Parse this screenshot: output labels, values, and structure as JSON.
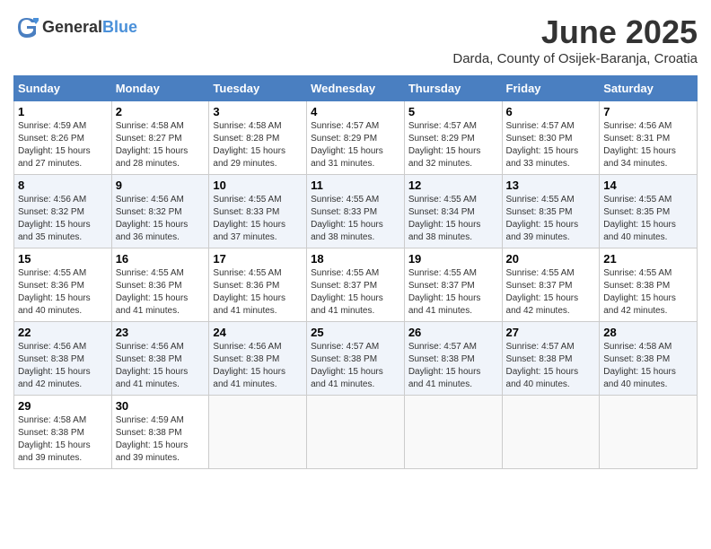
{
  "logo": {
    "general": "General",
    "blue": "Blue"
  },
  "title": "June 2025",
  "location": "Darda, County of Osijek-Baranja, Croatia",
  "days_header": [
    "Sunday",
    "Monday",
    "Tuesday",
    "Wednesday",
    "Thursday",
    "Friday",
    "Saturday"
  ],
  "weeks": [
    [
      {
        "day": "1",
        "info": "Sunrise: 4:59 AM\nSunset: 8:26 PM\nDaylight: 15 hours and 27 minutes."
      },
      {
        "day": "2",
        "info": "Sunrise: 4:58 AM\nSunset: 8:27 PM\nDaylight: 15 hours and 28 minutes."
      },
      {
        "day": "3",
        "info": "Sunrise: 4:58 AM\nSunset: 8:28 PM\nDaylight: 15 hours and 29 minutes."
      },
      {
        "day": "4",
        "info": "Sunrise: 4:57 AM\nSunset: 8:29 PM\nDaylight: 15 hours and 31 minutes."
      },
      {
        "day": "5",
        "info": "Sunrise: 4:57 AM\nSunset: 8:29 PM\nDaylight: 15 hours and 32 minutes."
      },
      {
        "day": "6",
        "info": "Sunrise: 4:57 AM\nSunset: 8:30 PM\nDaylight: 15 hours and 33 minutes."
      },
      {
        "day": "7",
        "info": "Sunrise: 4:56 AM\nSunset: 8:31 PM\nDaylight: 15 hours and 34 minutes."
      }
    ],
    [
      {
        "day": "8",
        "info": "Sunrise: 4:56 AM\nSunset: 8:32 PM\nDaylight: 15 hours and 35 minutes."
      },
      {
        "day": "9",
        "info": "Sunrise: 4:56 AM\nSunset: 8:32 PM\nDaylight: 15 hours and 36 minutes."
      },
      {
        "day": "10",
        "info": "Sunrise: 4:55 AM\nSunset: 8:33 PM\nDaylight: 15 hours and 37 minutes."
      },
      {
        "day": "11",
        "info": "Sunrise: 4:55 AM\nSunset: 8:33 PM\nDaylight: 15 hours and 38 minutes."
      },
      {
        "day": "12",
        "info": "Sunrise: 4:55 AM\nSunset: 8:34 PM\nDaylight: 15 hours and 38 minutes."
      },
      {
        "day": "13",
        "info": "Sunrise: 4:55 AM\nSunset: 8:35 PM\nDaylight: 15 hours and 39 minutes."
      },
      {
        "day": "14",
        "info": "Sunrise: 4:55 AM\nSunset: 8:35 PM\nDaylight: 15 hours and 40 minutes."
      }
    ],
    [
      {
        "day": "15",
        "info": "Sunrise: 4:55 AM\nSunset: 8:36 PM\nDaylight: 15 hours and 40 minutes."
      },
      {
        "day": "16",
        "info": "Sunrise: 4:55 AM\nSunset: 8:36 PM\nDaylight: 15 hours and 41 minutes."
      },
      {
        "day": "17",
        "info": "Sunrise: 4:55 AM\nSunset: 8:36 PM\nDaylight: 15 hours and 41 minutes."
      },
      {
        "day": "18",
        "info": "Sunrise: 4:55 AM\nSunset: 8:37 PM\nDaylight: 15 hours and 41 minutes."
      },
      {
        "day": "19",
        "info": "Sunrise: 4:55 AM\nSunset: 8:37 PM\nDaylight: 15 hours and 41 minutes."
      },
      {
        "day": "20",
        "info": "Sunrise: 4:55 AM\nSunset: 8:37 PM\nDaylight: 15 hours and 42 minutes."
      },
      {
        "day": "21",
        "info": "Sunrise: 4:55 AM\nSunset: 8:38 PM\nDaylight: 15 hours and 42 minutes."
      }
    ],
    [
      {
        "day": "22",
        "info": "Sunrise: 4:56 AM\nSunset: 8:38 PM\nDaylight: 15 hours and 42 minutes."
      },
      {
        "day": "23",
        "info": "Sunrise: 4:56 AM\nSunset: 8:38 PM\nDaylight: 15 hours and 41 minutes."
      },
      {
        "day": "24",
        "info": "Sunrise: 4:56 AM\nSunset: 8:38 PM\nDaylight: 15 hours and 41 minutes."
      },
      {
        "day": "25",
        "info": "Sunrise: 4:57 AM\nSunset: 8:38 PM\nDaylight: 15 hours and 41 minutes."
      },
      {
        "day": "26",
        "info": "Sunrise: 4:57 AM\nSunset: 8:38 PM\nDaylight: 15 hours and 41 minutes."
      },
      {
        "day": "27",
        "info": "Sunrise: 4:57 AM\nSunset: 8:38 PM\nDaylight: 15 hours and 40 minutes."
      },
      {
        "day": "28",
        "info": "Sunrise: 4:58 AM\nSunset: 8:38 PM\nDaylight: 15 hours and 40 minutes."
      }
    ],
    [
      {
        "day": "29",
        "info": "Sunrise: 4:58 AM\nSunset: 8:38 PM\nDaylight: 15 hours and 39 minutes."
      },
      {
        "day": "30",
        "info": "Sunrise: 4:59 AM\nSunset: 8:38 PM\nDaylight: 15 hours and 39 minutes."
      },
      null,
      null,
      null,
      null,
      null
    ]
  ]
}
